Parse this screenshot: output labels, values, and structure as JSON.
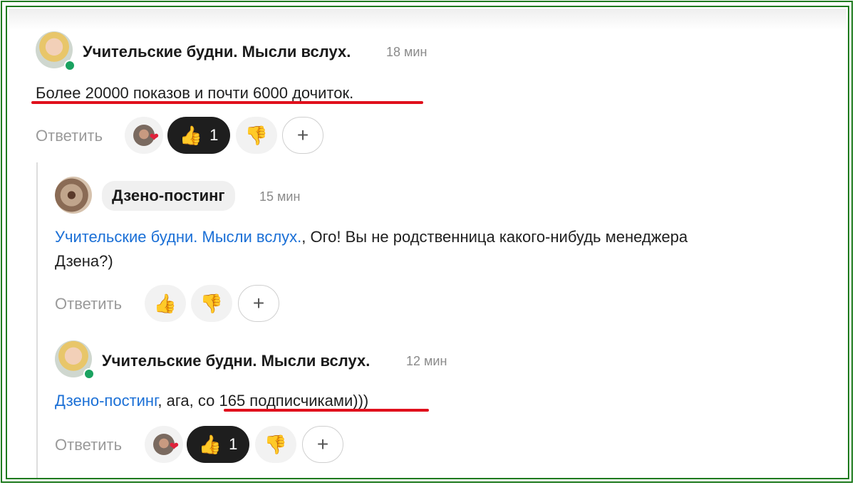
{
  "comments": [
    {
      "author": "Учительские будни. Мысли вслух.",
      "time": "18 мин",
      "text": "Более 20000 показов и почти 6000 дочиток.",
      "reply_label": "Ответить",
      "likes": "1"
    },
    {
      "author": "Дзено-постинг",
      "time": "15 мин",
      "mention": "Учительские будни. Мысли вслух.",
      "text_line1": ", Ого! Вы не родственница какого-нибудь менеджера",
      "text_line2": "Дзена?)",
      "reply_label": "Ответить"
    },
    {
      "author": "Учительские будни. Мысли вслух.",
      "time": "12 мин",
      "mention": "Дзено-постинг",
      "text": ", ага, со 165 подписчиками)))",
      "reply_label": "Ответить",
      "likes": "1"
    }
  ],
  "icons": {
    "like": "👍",
    "dislike": "👎",
    "add": "+"
  },
  "colors": {
    "frame": "#1e7a1e",
    "link": "#1a6fd6",
    "highlight_underline": "#e0101c",
    "online": "#1aa260"
  }
}
